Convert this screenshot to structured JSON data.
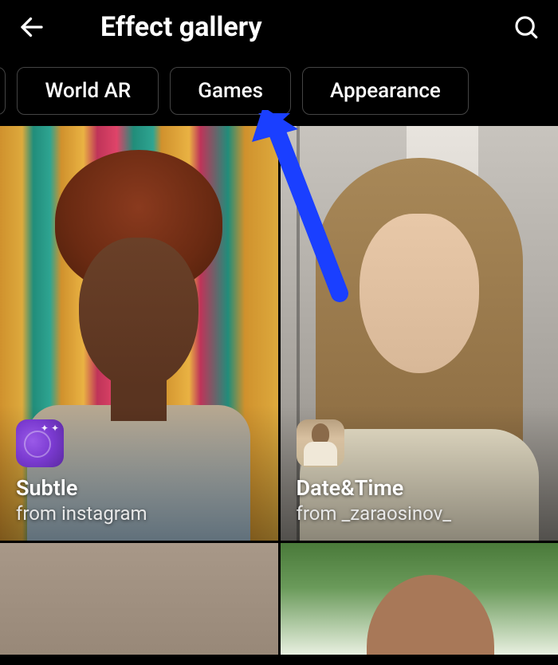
{
  "header": {
    "title": "Effect gallery"
  },
  "tabs": [
    {
      "label": "World AR"
    },
    {
      "label": "Games"
    },
    {
      "label": "Appearance"
    }
  ],
  "effects": [
    {
      "name": "Subtle",
      "from_prefix": "from ",
      "author": "instagram",
      "icon": "sparkle-lens-icon"
    },
    {
      "name": "Date&Time",
      "from_prefix": "from ",
      "author": "_zaraosinov_",
      "icon": "avatar-thumbnail"
    }
  ],
  "annotation": {
    "target": "tab-games"
  }
}
